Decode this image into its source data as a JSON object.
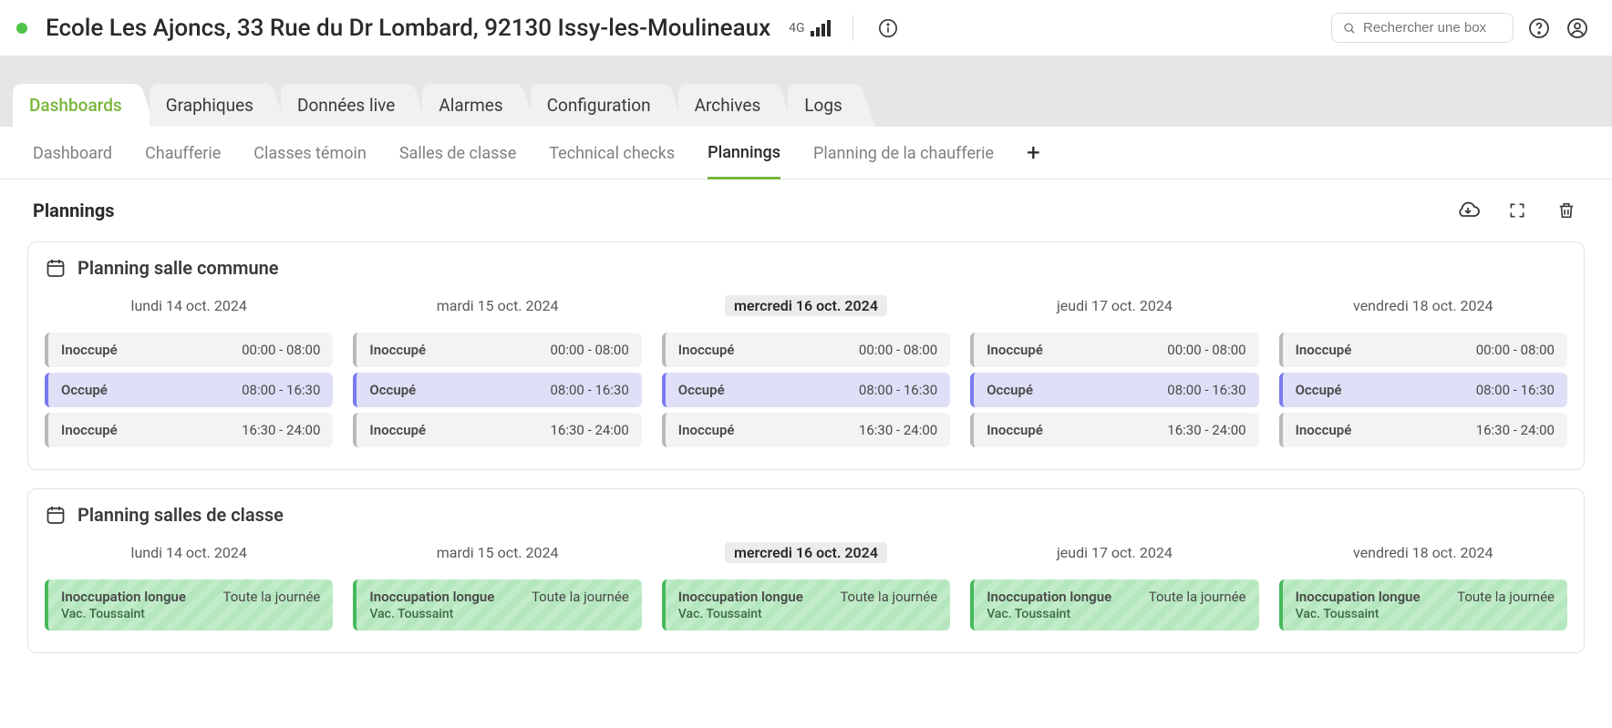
{
  "header": {
    "title": "Ecole Les Ajoncs, 33 Rue du Dr Lombard, 92130 Issy-les-Moulineaux",
    "network": "4G",
    "search_placeholder": "Rechercher une box"
  },
  "tabs": [
    {
      "label": "Dashboards",
      "active": true
    },
    {
      "label": "Graphiques",
      "active": false
    },
    {
      "label": "Données live",
      "active": false
    },
    {
      "label": "Alarmes",
      "active": false
    },
    {
      "label": "Configuration",
      "active": false
    },
    {
      "label": "Archives",
      "active": false
    },
    {
      "label": "Logs",
      "active": false
    }
  ],
  "subtabs": [
    {
      "label": "Dashboard",
      "active": false
    },
    {
      "label": "Chaufferie",
      "active": false
    },
    {
      "label": "Classes témoin",
      "active": false
    },
    {
      "label": "Salles de classe",
      "active": false
    },
    {
      "label": "Technical checks",
      "active": false
    },
    {
      "label": "Plannings",
      "active": true
    },
    {
      "label": "Planning de la chaufferie",
      "active": false
    }
  ],
  "page": {
    "title": "Plannings"
  },
  "days": [
    {
      "label": "lundi 14 oct. 2024",
      "current": false
    },
    {
      "label": "mardi 15 oct. 2024",
      "current": false
    },
    {
      "label": "mercredi 16 oct. 2024",
      "current": true
    },
    {
      "label": "jeudi 17 oct. 2024",
      "current": false
    },
    {
      "label": "vendredi 18 oct. 2024",
      "current": false
    }
  ],
  "plannings": [
    {
      "title": "Planning salle commune",
      "type": "slots",
      "columns": [
        [
          {
            "status": "Inoccupé",
            "time": "00:00 - 08:00",
            "kind": "inoccupe"
          },
          {
            "status": "Occupé",
            "time": "08:00 - 16:30",
            "kind": "occupe"
          },
          {
            "status": "Inoccupé",
            "time": "16:30 - 24:00",
            "kind": "inoccupe"
          }
        ],
        [
          {
            "status": "Inoccupé",
            "time": "00:00 - 08:00",
            "kind": "inoccupe"
          },
          {
            "status": "Occupé",
            "time": "08:00 - 16:30",
            "kind": "occupe"
          },
          {
            "status": "Inoccupé",
            "time": "16:30 - 24:00",
            "kind": "inoccupe"
          }
        ],
        [
          {
            "status": "Inoccupé",
            "time": "00:00 - 08:00",
            "kind": "inoccupe"
          },
          {
            "status": "Occupé",
            "time": "08:00 - 16:30",
            "kind": "occupe"
          },
          {
            "status": "Inoccupé",
            "time": "16:30 - 24:00",
            "kind": "inoccupe"
          }
        ],
        [
          {
            "status": "Inoccupé",
            "time": "00:00 - 08:00",
            "kind": "inoccupe"
          },
          {
            "status": "Occupé",
            "time": "08:00 - 16:30",
            "kind": "occupe"
          },
          {
            "status": "Inoccupé",
            "time": "16:30 - 24:00",
            "kind": "inoccupe"
          }
        ],
        [
          {
            "status": "Inoccupé",
            "time": "00:00 - 08:00",
            "kind": "inoccupe"
          },
          {
            "status": "Occupé",
            "time": "08:00 - 16:30",
            "kind": "occupe"
          },
          {
            "status": "Inoccupé",
            "time": "16:30 - 24:00",
            "kind": "inoccupe"
          }
        ]
      ]
    },
    {
      "title": "Planning salles de classe",
      "type": "green",
      "columns": [
        [
          {
            "status": "Inoccupation longue",
            "time": "Toute la journée",
            "sub": "Vac. Toussaint",
            "kind": "green"
          }
        ],
        [
          {
            "status": "Inoccupation longue",
            "time": "Toute la journée",
            "sub": "Vac. Toussaint",
            "kind": "green"
          }
        ],
        [
          {
            "status": "Inoccupation longue",
            "time": "Toute la journée",
            "sub": "Vac. Toussaint",
            "kind": "green"
          }
        ],
        [
          {
            "status": "Inoccupation longue",
            "time": "Toute la journée",
            "sub": "Vac. Toussaint",
            "kind": "green"
          }
        ],
        [
          {
            "status": "Inoccupation longue",
            "time": "Toute la journée",
            "sub": "Vac. Toussaint",
            "kind": "green"
          }
        ]
      ]
    }
  ]
}
